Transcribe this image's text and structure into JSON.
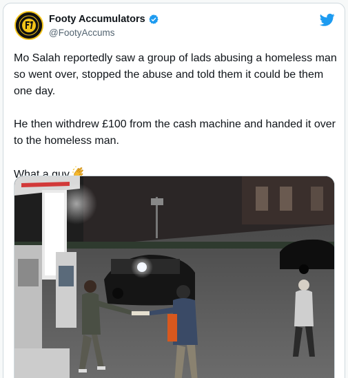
{
  "tweet": {
    "author": {
      "display_name": "Footy Accumulators",
      "handle": "@FootyAccums",
      "verified": true,
      "avatar_icon": "footy-accumulators-logo"
    },
    "platform_icon": "twitter-bird-icon",
    "paragraphs": [
      "Mo Salah reportedly saw a group of lads abusing a homeless man so went over, stopped the abuse and told them it could be them one day.",
      "He then withdrew £100 from the cash machine and handed it over to the homeless man.",
      "What a guy"
    ],
    "emoji": "clapping-hands-icon"
  },
  "colors": {
    "twitter_blue": "#1d9bf0",
    "text": "#0f1419",
    "muted": "#536471",
    "border": "#cfd9de"
  }
}
